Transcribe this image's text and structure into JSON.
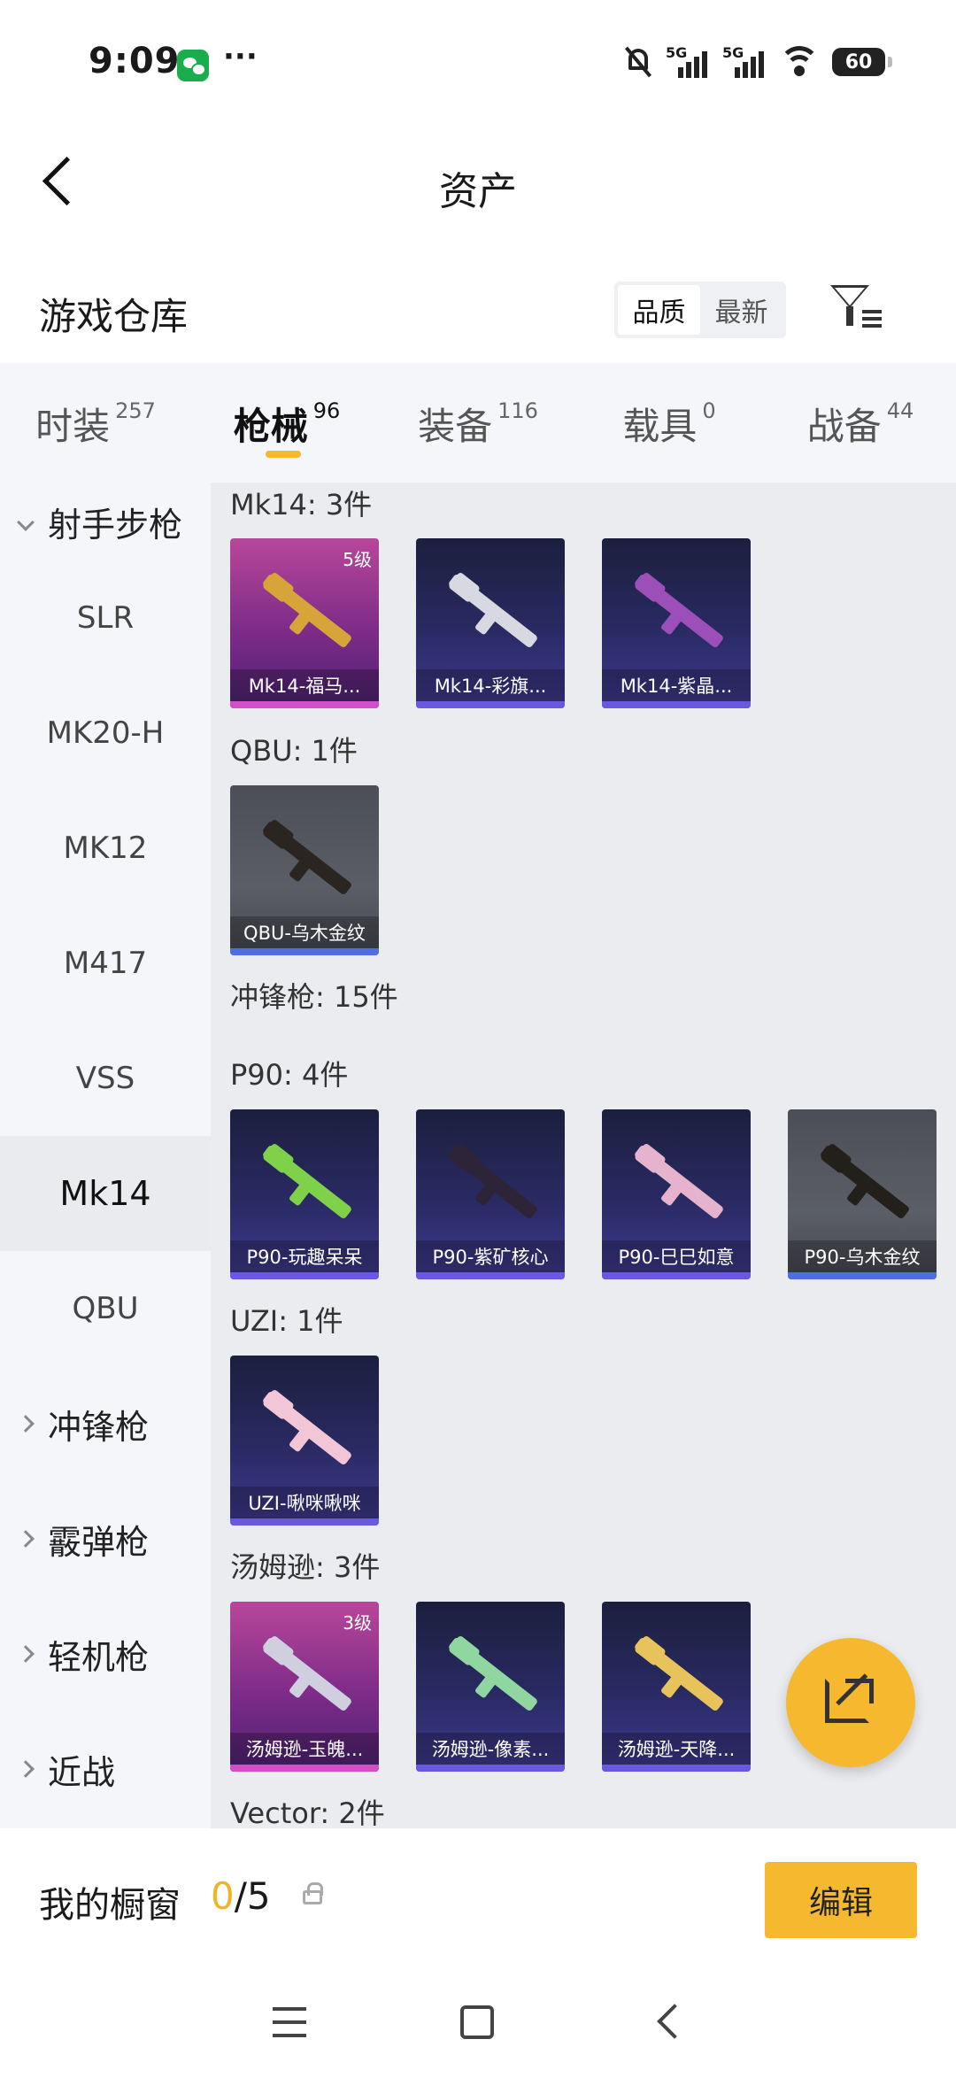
{
  "status": {
    "time": "9:09",
    "dots": "···",
    "sig1": "5G",
    "sig2": "5G",
    "battery": "60"
  },
  "header": {
    "title": "资产"
  },
  "subheader": {
    "section_title": "游戏仓库",
    "sort_options": [
      "品质",
      "最新"
    ]
  },
  "tabs": [
    {
      "label": "时装",
      "count": "257"
    },
    {
      "label": "枪械",
      "count": "96"
    },
    {
      "label": "装备",
      "count": "116"
    },
    {
      "label": "载具",
      "count": "0"
    },
    {
      "label": "战备",
      "count": "44"
    }
  ],
  "sidebar": [
    "射手步枪",
    "SLR",
    "MK20-H",
    "MK12",
    "M417",
    "VSS",
    "Mk14",
    "QBU",
    "冲锋枪",
    "霰弹枪",
    "轻机枪",
    "近战"
  ],
  "groups": [
    {
      "title": "Mk14: 3件",
      "cards": [
        {
          "name": "Mk14-福马...",
          "level": "5级",
          "tier": "purple"
        },
        {
          "name": "Mk14-彩旗...",
          "tier": "blue"
        },
        {
          "name": "Mk14-紫晶...",
          "tier": "blue"
        }
      ]
    },
    {
      "title": "QBU: 1件",
      "cards": [
        {
          "name": "QBU-乌木金纹",
          "tier": "gray"
        }
      ]
    },
    {
      "title": "冲锋枪: 15件",
      "cards": []
    },
    {
      "title": "P90: 4件",
      "cards": [
        {
          "name": "P90-玩趣呆呆",
          "tier": "blue"
        },
        {
          "name": "P90-紫矿核心",
          "tier": "blue"
        },
        {
          "name": "P90-巳巳如意",
          "tier": "blue"
        },
        {
          "name": "P90-乌木金纹",
          "tier": "gray"
        }
      ]
    },
    {
      "title": "UZI: 1件",
      "cards": [
        {
          "name": "UZI-啾咪啾咪",
          "tier": "blue"
        }
      ]
    },
    {
      "title": "汤姆逊: 3件",
      "cards": [
        {
          "name": "汤姆逊-玉魄...",
          "level": "3级",
          "tier": "purple"
        },
        {
          "name": "汤姆逊-像素...",
          "tier": "blue"
        },
        {
          "name": "汤姆逊-天降...",
          "tier": "blue"
        }
      ]
    },
    {
      "title": "Vector: 2件",
      "cards": []
    }
  ],
  "bottom": {
    "window_label": "我的橱窗",
    "current": "0",
    "total": "/5",
    "edit": "编辑"
  },
  "colors": {
    "accent": "#f5b82e",
    "rare_purple": "#b8479a",
    "epic_blue": "#2a2a64",
    "standard_gray": "#5b5e67"
  }
}
